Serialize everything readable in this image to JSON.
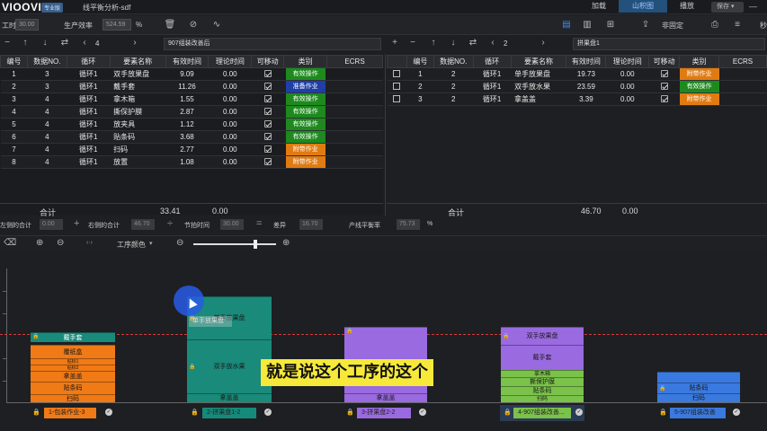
{
  "app": {
    "logo": "VIOOVI",
    "badge": "专业版",
    "doc_title": "线平衡分析-sdf"
  },
  "top_tabs": [
    {
      "label": "加载",
      "active": false
    },
    {
      "label": "山积图",
      "active": true
    },
    {
      "label": "播放",
      "active": false
    }
  ],
  "save_label": "保存",
  "toolbar": {
    "unit_label": "工时",
    "unit_value": "30.00",
    "efficiency_label": "生产效率",
    "efficiency_value": "524.59",
    "percent": "%",
    "nonfixed_label": "非固定",
    "trail_label": "秒"
  },
  "left_panel": {
    "index": "4",
    "plan_name": "907组装改善后",
    "columns": [
      "编号",
      "数据NO.",
      "循环",
      "要素名称",
      "有效时间",
      "理论时间",
      "可移动",
      "类别",
      "ECRS"
    ],
    "rows": [
      {
        "no": "1",
        "data_no": "3",
        "cycle": "循环1",
        "name": "双手放果盘",
        "eff": "9.09",
        "theo": "0.00",
        "movable": true,
        "cat": "有效操作",
        "cat_color": "#1e8a1e"
      },
      {
        "no": "2",
        "data_no": "3",
        "cycle": "循环1",
        "name": "戴手套",
        "eff": "11.26",
        "theo": "0.00",
        "movable": true,
        "cat": "准备作业",
        "cat_color": "#1f3fa8"
      },
      {
        "no": "3",
        "data_no": "4",
        "cycle": "循环1",
        "name": "拿木箱",
        "eff": "1.55",
        "theo": "0.00",
        "movable": true,
        "cat": "有效操作",
        "cat_color": "#1e8a1e"
      },
      {
        "no": "4",
        "data_no": "4",
        "cycle": "循环1",
        "name": "撕保护膜",
        "eff": "2.87",
        "theo": "0.00",
        "movable": true,
        "cat": "有效操作",
        "cat_color": "#1e8a1e"
      },
      {
        "no": "5",
        "data_no": "4",
        "cycle": "循环1",
        "name": "放夹具",
        "eff": "1.12",
        "theo": "0.00",
        "movable": true,
        "cat": "有效操作",
        "cat_color": "#1e8a1e"
      },
      {
        "no": "6",
        "data_no": "4",
        "cycle": "循环1",
        "name": "贴条码",
        "eff": "3.68",
        "theo": "0.00",
        "movable": true,
        "cat": "有效操作",
        "cat_color": "#1e8a1e"
      },
      {
        "no": "7",
        "data_no": "4",
        "cycle": "循环1",
        "name": "扫码",
        "eff": "2.77",
        "theo": "0.00",
        "movable": true,
        "cat": "附带作业",
        "cat_color": "#e07b12"
      },
      {
        "no": "8",
        "data_no": "4",
        "cycle": "循环1",
        "name": "放置",
        "eff": "1.08",
        "theo": "0.00",
        "movable": true,
        "cat": "附带作业",
        "cat_color": "#e07b12"
      }
    ],
    "total_label": "合计",
    "total_eff": "33.41",
    "total_theo": "0.00"
  },
  "right_panel": {
    "index": "2",
    "plan_name": "拼果盘1",
    "columns": [
      "",
      "编号",
      "数据NO.",
      "循环",
      "要素名称",
      "有效时间",
      "理论时间",
      "可移动",
      "类别",
      "ECRS"
    ],
    "rows": [
      {
        "no": "1",
        "data_no": "2",
        "cycle": "循环1",
        "name": "单手放果盘",
        "eff": "19.73",
        "theo": "0.00",
        "movable": true,
        "cat": "附带作业",
        "cat_color": "#e07b12"
      },
      {
        "no": "2",
        "data_no": "2",
        "cycle": "循环1",
        "name": "双手放水果",
        "eff": "23.59",
        "theo": "0.00",
        "movable": true,
        "cat": "有效操作",
        "cat_color": "#1e8a1e"
      },
      {
        "no": "3",
        "data_no": "2",
        "cycle": "循环1",
        "name": "拿盖盖",
        "eff": "3.39",
        "theo": "0.00",
        "movable": true,
        "cat": "附带作业",
        "cat_color": "#e07b12"
      }
    ],
    "total_label": "合计",
    "total_eff": "46.70",
    "total_theo": "0.00"
  },
  "summary": {
    "left_total_label": "左侧的合计",
    "left_total": "0.00",
    "right_total_label": "右侧的合计",
    "right_total": "46.70",
    "takt_label": "节拍时间",
    "takt": "30.00",
    "diff_label": "差异",
    "diff": "16.70",
    "balance_label": "产线平衡率",
    "balance": "75.73",
    "percent": "%"
  },
  "chart_tb": {
    "color_label": "工序颜色"
  },
  "stations": [
    {
      "label": "1-包装作业-3",
      "color": "#e87a16"
    },
    {
      "label": "2-拼果盘1-2",
      "color": "#168a7a"
    },
    {
      "label": "3-拼果盘2-2",
      "color": "#9a6ae0"
    },
    {
      "label": "4-907组装改善...",
      "color": "#7ac24a"
    },
    {
      "label": "5-907组装改善",
      "color": "#3a7ae0"
    }
  ],
  "blocks": {
    "s1": [
      "戴手套",
      "覆纸盒",
      "贴标1",
      "贴标2",
      "拿盖盖",
      "贴条码",
      "扫码"
    ],
    "s2": [
      "单手放果盘",
      "双手放水果",
      "拿盖盖"
    ],
    "s3": [
      "拿盖盖"
    ],
    "s4": [
      "双手放果盘",
      "戴手套",
      "拿木箱",
      "撕保护膜",
      "贴条码",
      "扫码"
    ],
    "s5": [
      "贴条码",
      "扫码"
    ]
  },
  "hover_label": "单手放果盘",
  "subtitle": "就是说这个工序的这个"
}
